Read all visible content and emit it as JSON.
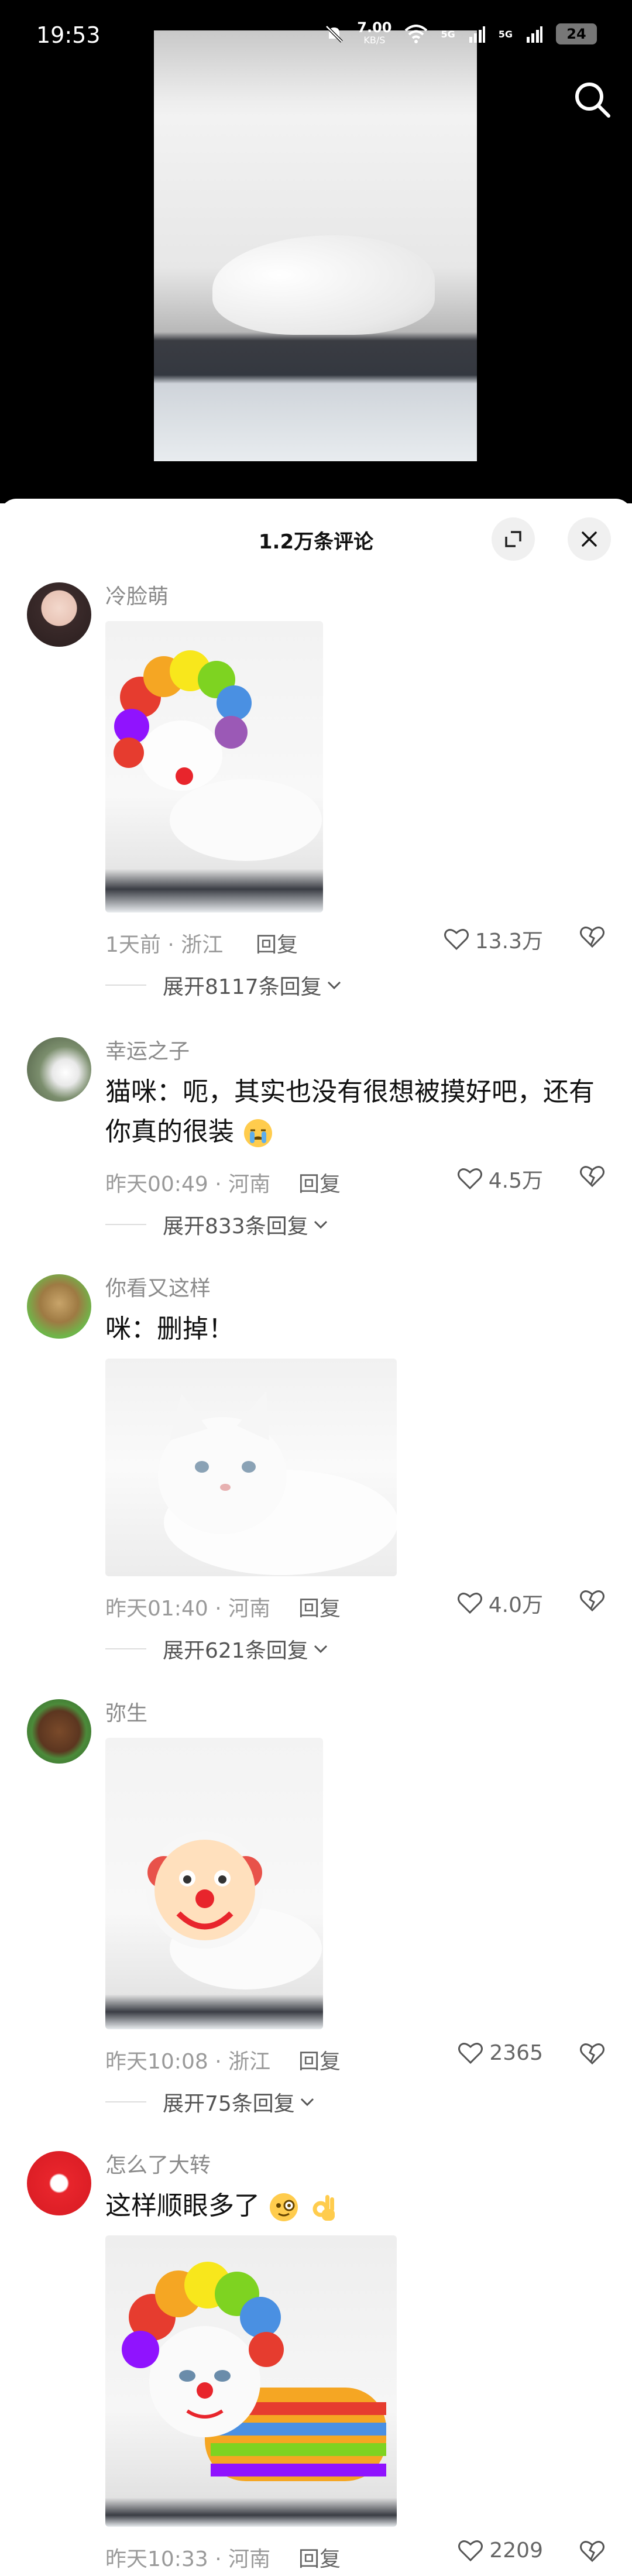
{
  "status_bar": {
    "time": "19:53",
    "net_speed": "7.00",
    "net_unit": "KB/S",
    "signal1": "5G",
    "signal2": "5G",
    "battery": "24"
  },
  "sheet": {
    "title": "1.2万条评论"
  },
  "comments": [
    {
      "username": "冷脸萌",
      "text": "",
      "time_loc": "1天前 · 浙江",
      "reply_label": "回复",
      "likes": "13.3万",
      "expand_label": "展开8117条回复"
    },
    {
      "username": "幸运之子",
      "text": "猫咪：呃，其实也没有很想被摸好吧，还有你真的很装",
      "time_loc": "昨天00:49 · 河南",
      "reply_label": "回复",
      "likes": "4.5万",
      "expand_label": "展开833条回复"
    },
    {
      "username": "你看又这样",
      "text": "咪：删掉！",
      "time_loc": "昨天01:40 · 河南",
      "reply_label": "回复",
      "likes": "4.0万",
      "expand_label": "展开621条回复"
    },
    {
      "username": "弥生",
      "text": "",
      "time_loc": "昨天10:08 · 浙江",
      "reply_label": "回复",
      "likes": "2365",
      "expand_label": "展开75条回复"
    },
    {
      "username": "怎么了大转",
      "text": "这样顺眼多了",
      "time_loc": "昨天10:33 · 河南",
      "reply_label": "回复",
      "likes": "2209",
      "expand_label": ""
    }
  ],
  "icons": {
    "search": "search-icon",
    "expand": "expand-icon",
    "close": "close-icon",
    "like": "heart-icon",
    "dislike": "broken-heart-icon",
    "chevron": "chevron-down-icon"
  }
}
